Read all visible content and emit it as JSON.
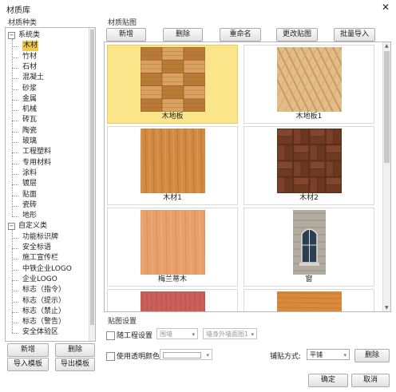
{
  "window": {
    "title": "材质库",
    "close_glyph": "✕"
  },
  "left_panel": {
    "group_label": "材质种类",
    "tree": [
      {
        "label": "系统类",
        "expander": "⊟"
      },
      {
        "label": "木材",
        "selected": true
      },
      {
        "label": "竹材"
      },
      {
        "label": "石材"
      },
      {
        "label": "混凝土"
      },
      {
        "label": "砂浆"
      },
      {
        "label": "金属"
      },
      {
        "label": "机械"
      },
      {
        "label": "砖瓦"
      },
      {
        "label": "陶瓷"
      },
      {
        "label": "玻璃"
      },
      {
        "label": "工程塑料"
      },
      {
        "label": "专用材料"
      },
      {
        "label": "涂料"
      },
      {
        "label": "镀层"
      },
      {
        "label": "贴面"
      },
      {
        "label": "瓷砖"
      },
      {
        "label": "地形"
      },
      {
        "label": "自定义类",
        "expander": "⊟"
      },
      {
        "label": "功能标识牌"
      },
      {
        "label": "安全标语"
      },
      {
        "label": "施工宣传栏"
      },
      {
        "label": "中铁企业LOGO"
      },
      {
        "label": "企业LOGO"
      },
      {
        "label": "标志（指令）"
      },
      {
        "label": "标志（提示）"
      },
      {
        "label": "标志（禁止）"
      },
      {
        "label": "标志（警告）"
      },
      {
        "label": "安全体验区"
      }
    ],
    "buttons": {
      "new": "新增",
      "delete": "删除",
      "import_template": "导入模板",
      "export_template": "导出模板"
    }
  },
  "right_panel": {
    "group_label": "材质贴图",
    "toolbar": {
      "new": "新增",
      "delete": "删除",
      "rename": "重命名",
      "change_map": "更改贴图",
      "batch_import": "批量导入"
    },
    "materials": [
      {
        "name": "木地板",
        "selected": true,
        "pattern": "parquet"
      },
      {
        "name": "木地板1",
        "pattern": "herringbone"
      },
      {
        "name": "木材1",
        "pattern": "plank-orange"
      },
      {
        "name": "木材2",
        "pattern": "basket-dark"
      },
      {
        "name": "梅兰蒂木",
        "pattern": "plank-light"
      },
      {
        "name": "窗",
        "pattern": "window"
      },
      {
        "name": "",
        "pattern": "plank-red"
      },
      {
        "name": "",
        "pattern": "plank-amber"
      }
    ]
  },
  "settings": {
    "group_label": "贴图设置",
    "follow_project": "随工程设置",
    "combo1": "围墙",
    "combo2": "墙身外墙面图1",
    "use_transparent_color": "使用透明颜色:",
    "tiling_label": "铺贴方式:",
    "tiling_value": "平铺",
    "delete": "删除"
  },
  "footer": {
    "ok": "确定",
    "cancel": "取消"
  }
}
